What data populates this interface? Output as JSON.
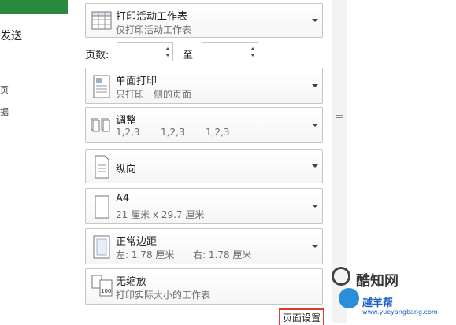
{
  "left_nav": {
    "send_label": "发送",
    "item2": "页",
    "item3": "据"
  },
  "print_what": {
    "title": "打印活动工作表",
    "subtitle": "仅打印活动工作表"
  },
  "pages": {
    "label": "页数:",
    "from_value": "",
    "to_label": "至",
    "to_value": ""
  },
  "sides": {
    "title": "单面打印",
    "subtitle": "只打印一侧的页面"
  },
  "collate": {
    "title": "调整",
    "subtitle_a": "1,2,3",
    "subtitle_b": "1,2,3",
    "subtitle_c": "1,2,3"
  },
  "orientation": {
    "title": "纵向"
  },
  "paper": {
    "title": "A4",
    "subtitle": "21 厘米 x 29.7 厘米"
  },
  "margins": {
    "title": "正常边距",
    "left": "左: 1.78 厘米",
    "right": "右: 1.78 厘米"
  },
  "scaling": {
    "title": "无缩放",
    "subtitle": "打印实际大小的工作表",
    "icon_text": "100"
  },
  "page_setup_link": "页面设置",
  "watermark": {
    "brand": "酷知网",
    "site": "越羊帮",
    "url": "www.yueyangbang.com"
  },
  "colors": {
    "accent": "#2b8a3e",
    "highlight": "#e03b24"
  }
}
